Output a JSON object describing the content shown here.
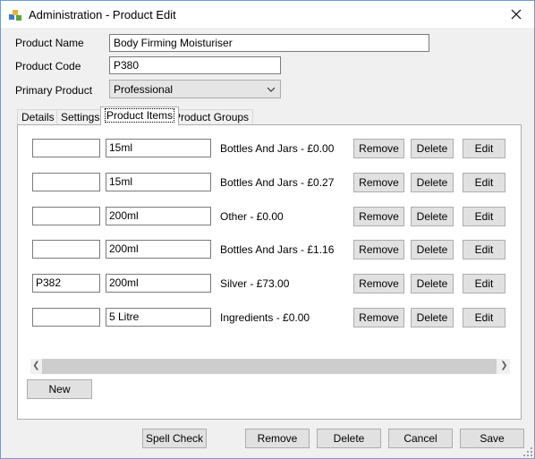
{
  "window": {
    "title": "Administration - Product Edit"
  },
  "form": {
    "product_name_label": "Product Name",
    "product_name_value": "Body Firming Moisturiser",
    "product_code_label": "Product Code",
    "product_code_value": "P380",
    "primary_product_label": "Primary Product",
    "primary_product_value": "Professional"
  },
  "tabs": [
    {
      "label": "Details"
    },
    {
      "label": "Settings"
    },
    {
      "label": "Product Items",
      "active": true
    },
    {
      "label": "Product Groups"
    }
  ],
  "items": [
    {
      "code": "",
      "size": "15ml",
      "description": "Bottles And Jars - £0.00"
    },
    {
      "code": "",
      "size": "15ml",
      "description": "Bottles And Jars - £0.27"
    },
    {
      "code": "",
      "size": "200ml",
      "description": "Other - £0.00"
    },
    {
      "code": "",
      "size": "200ml",
      "description": "Bottles And Jars - £1.16"
    },
    {
      "code": "P382",
      "size": "200ml",
      "description": "Silver - £73.00"
    },
    {
      "code": "",
      "size": "5 Litre",
      "description": "Ingredients - £0.00"
    }
  ],
  "row_buttons": {
    "remove": "Remove",
    "delete": "Delete",
    "edit": "Edit"
  },
  "new_button": "New",
  "footer": {
    "spell_check": "Spell Check",
    "remove": "Remove",
    "delete": "Delete",
    "cancel": "Cancel",
    "save": "Save"
  },
  "colors": {
    "window_border": "#6b9bd2",
    "button_face": "#e1e1e1",
    "panel": "#f0f0f0"
  }
}
